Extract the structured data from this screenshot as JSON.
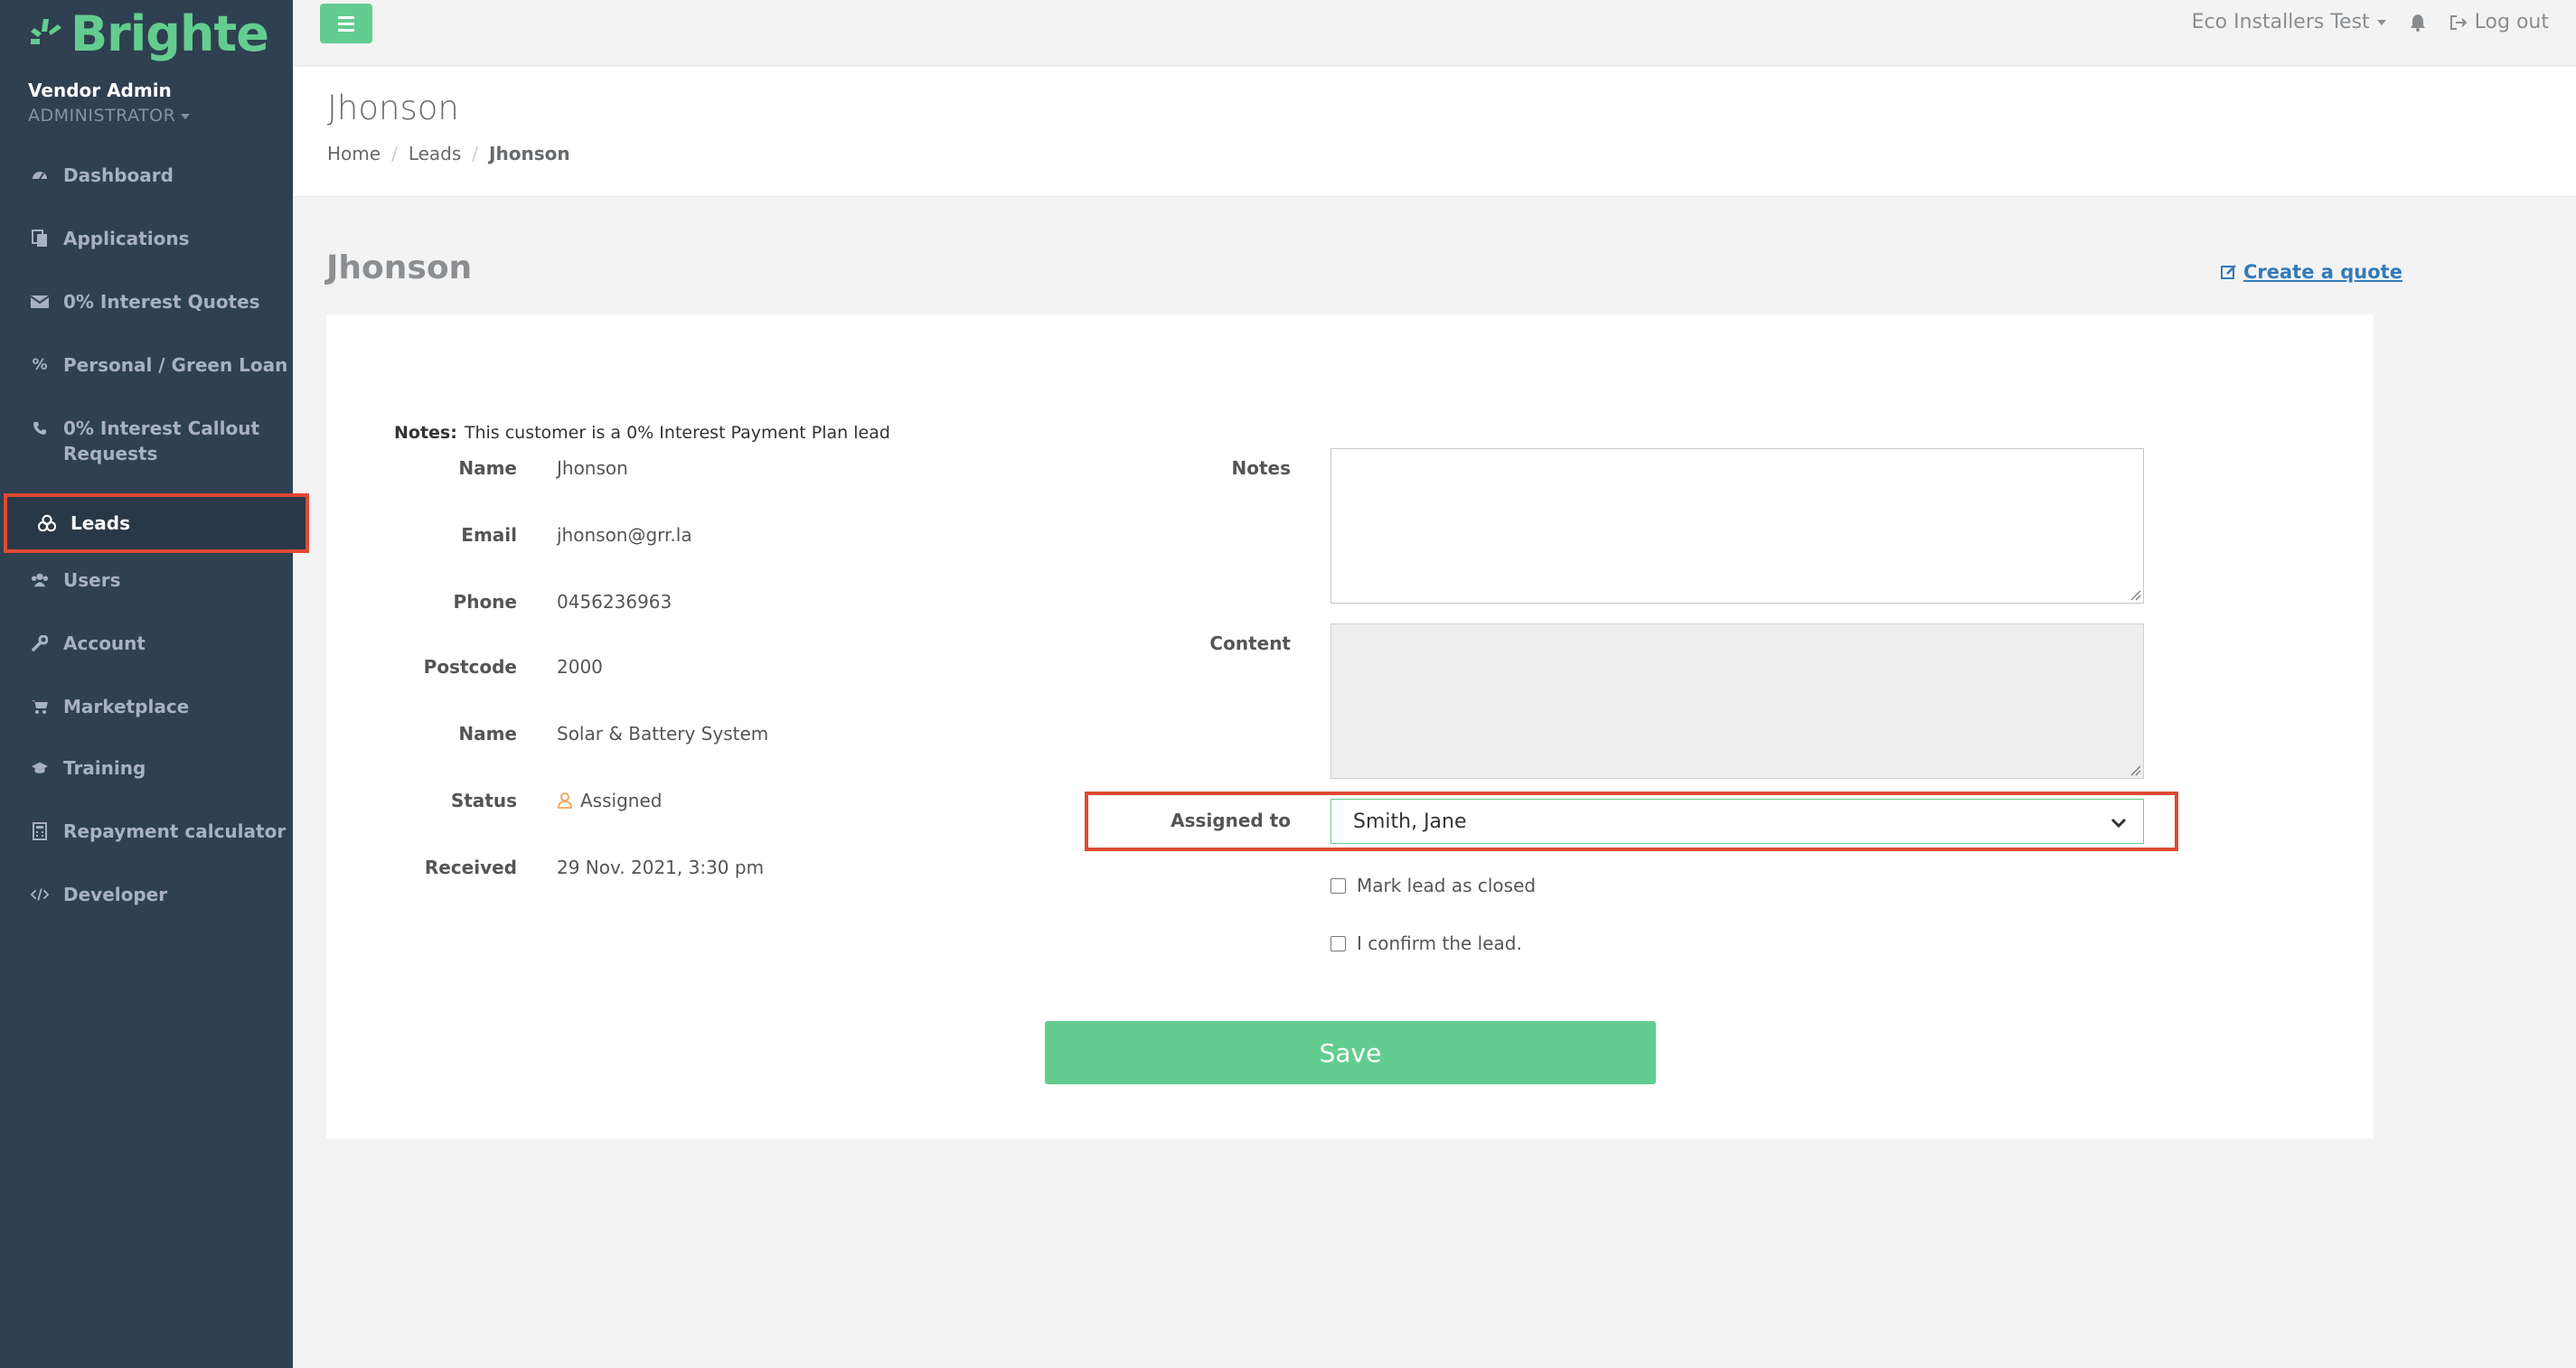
{
  "brand": {
    "name": "Brighte",
    "color": "#63cd8f"
  },
  "profile": {
    "name": "Vendor Admin",
    "role": "ADMINISTRATOR"
  },
  "sidebar": {
    "items": [
      {
        "label": "Dashboard",
        "icon": "dashboard-icon"
      },
      {
        "label": "Applications",
        "icon": "copy-icon"
      },
      {
        "label": "0% Interest Quotes",
        "icon": "envelope-icon"
      },
      {
        "label": "Personal / Green Loan",
        "icon": "percent-icon"
      },
      {
        "label": "0% Interest Callout Requests",
        "icon": "phone-icon"
      },
      {
        "label": "Leads",
        "icon": "leads-icon",
        "active": true
      },
      {
        "label": "Users",
        "icon": "users-icon"
      },
      {
        "label": "Account",
        "icon": "wrench-icon"
      },
      {
        "label": "Marketplace",
        "icon": "cart-icon"
      },
      {
        "label": "Training",
        "icon": "graduation-cap-icon"
      },
      {
        "label": "Repayment calculator",
        "icon": "calculator-icon"
      },
      {
        "label": "Developer",
        "icon": "code-icon"
      }
    ]
  },
  "topbar": {
    "org": "Eco Installers Test",
    "logout": "Log out"
  },
  "heading": {
    "title": "Jhonson",
    "breadcrumb": [
      "Home",
      "Leads",
      "Jhonson"
    ]
  },
  "main": {
    "section_title": "Jhonson",
    "create_quote": "Create a quote",
    "notes_label": "Notes:",
    "notes_text": "This customer is a 0% Interest Payment Plan lead",
    "details": [
      {
        "label": "Name",
        "value": "Jhonson"
      },
      {
        "label": "Email",
        "value": "jhonson@grr.la"
      },
      {
        "label": "Phone",
        "value": "0456236963"
      },
      {
        "label": "Postcode",
        "value": "2000"
      },
      {
        "label": "Name",
        "value": "Solar & Battery System"
      },
      {
        "label": "Status",
        "value": "Assigned"
      },
      {
        "label": "Received",
        "value": "29 Nov. 2021, 3:30 pm"
      }
    ],
    "form": {
      "notes_label": "Notes",
      "notes_value": "",
      "content_label": "Content",
      "content_value": "",
      "assigned_label": "Assigned to",
      "assigned_value": "Smith, Jane",
      "close_label": "Mark lead as closed",
      "confirm_label": "I confirm the lead.",
      "save_label": "Save"
    }
  },
  "colors": {
    "highlight": "#e04a32",
    "sidebar": "#2f4050",
    "accent": "#63cd8f",
    "link": "#337ab7"
  }
}
